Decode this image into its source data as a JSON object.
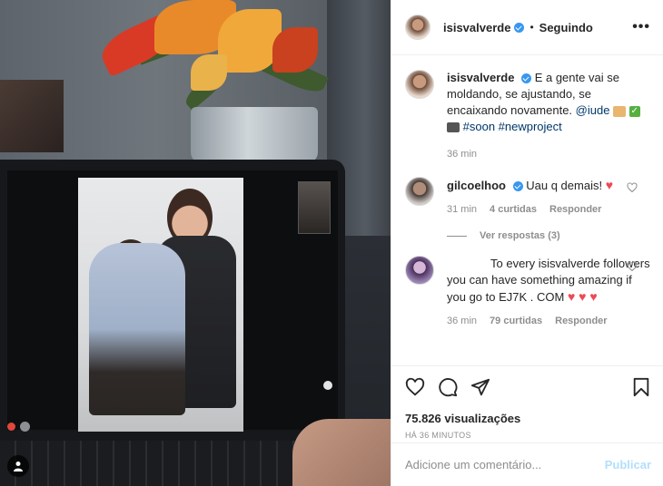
{
  "header": {
    "username": "isisvalverde",
    "separator": "•",
    "follow_status": "Seguindo",
    "more_label": "•••"
  },
  "caption": {
    "username": "isisvalverde",
    "text": "E a gente vai se moldando, se ajustando, se encaixando novamente.",
    "mention": "@iude",
    "tags": "#soon #newproject",
    "time": "36 min"
  },
  "comments": [
    {
      "username": "gilcoelhoo",
      "text": "Uau q demais!",
      "time": "31 min",
      "likes": "4 curtidas",
      "reply": "Responder",
      "view_replies": "Ver respostas (3)"
    },
    {
      "username": "",
      "text": "To every isisvalverde followers you can have something amazing if you go to EJ7K . COM",
      "time": "36 min",
      "likes": "79 curtidas",
      "reply": "Responder"
    }
  ],
  "stats": {
    "views_count": "75.826",
    "views_label": "visualizações",
    "posted": "Há 36 minutos"
  },
  "add_comment": {
    "placeholder": "Adicione um comentário...",
    "publish": "Publicar"
  },
  "icons": [
    "heart-icon",
    "comment-icon",
    "share-icon",
    "bookmark-icon",
    "user-tag-icon"
  ],
  "colors": {
    "accent": "#3897f0",
    "like_red": "#ed4956",
    "publish_disabled": "#b2dffc",
    "meta_gray": "#8e8e8e"
  }
}
